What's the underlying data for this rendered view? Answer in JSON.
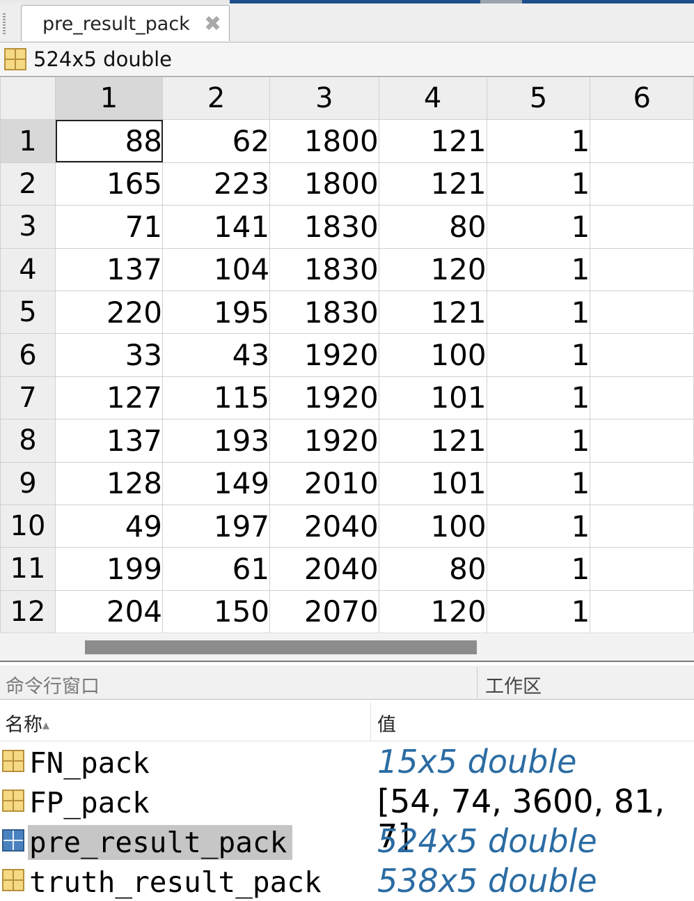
{
  "tab": {
    "label": "pre_result_pack",
    "close": "✖"
  },
  "info": {
    "size_label": "524x5 double"
  },
  "table": {
    "column_headers": [
      "1",
      "2",
      "3",
      "4",
      "5",
      "6"
    ],
    "rows": [
      {
        "label": "1",
        "cells": [
          "88",
          "62",
          "1800",
          "121",
          "1",
          ""
        ]
      },
      {
        "label": "2",
        "cells": [
          "165",
          "223",
          "1800",
          "121",
          "1",
          ""
        ]
      },
      {
        "label": "3",
        "cells": [
          "71",
          "141",
          "1830",
          "80",
          "1",
          ""
        ]
      },
      {
        "label": "4",
        "cells": [
          "137",
          "104",
          "1830",
          "120",
          "1",
          ""
        ]
      },
      {
        "label": "5",
        "cells": [
          "220",
          "195",
          "1830",
          "121",
          "1",
          ""
        ]
      },
      {
        "label": "6",
        "cells": [
          "33",
          "43",
          "1920",
          "100",
          "1",
          ""
        ]
      },
      {
        "label": "7",
        "cells": [
          "127",
          "115",
          "1920",
          "101",
          "1",
          ""
        ]
      },
      {
        "label": "8",
        "cells": [
          "137",
          "193",
          "1920",
          "121",
          "1",
          ""
        ]
      },
      {
        "label": "9",
        "cells": [
          "128",
          "149",
          "2010",
          "101",
          "1",
          ""
        ]
      },
      {
        "label": "10",
        "cells": [
          "49",
          "197",
          "2040",
          "100",
          "1",
          ""
        ]
      },
      {
        "label": "11",
        "cells": [
          "199",
          "61",
          "2040",
          "80",
          "1",
          ""
        ]
      },
      {
        "label": "12",
        "cells": [
          "204",
          "150",
          "2070",
          "120",
          "1",
          ""
        ]
      }
    ]
  },
  "panels": {
    "command_window": "命令行窗口",
    "workspace": "工作区"
  },
  "workspace": {
    "name_header": "名称",
    "value_header": "值",
    "variables": [
      {
        "name": "FN_pack",
        "value": "15x5 double",
        "italic": true,
        "selected": false
      },
      {
        "name": "FP_pack",
        "value": "[54, 74, 3600, 81, 7]",
        "italic": false,
        "selected": false
      },
      {
        "name": "pre_result_pack",
        "value": "524x5 double",
        "italic": true,
        "selected": true
      },
      {
        "name": "truth_result_pack",
        "value": "538x5 double",
        "italic": true,
        "selected": false
      }
    ]
  },
  "colors": {
    "accent_blue": "#1f4e8c",
    "value_italic": "#2b6ca3",
    "selection_gray": "#c6c6c6"
  }
}
